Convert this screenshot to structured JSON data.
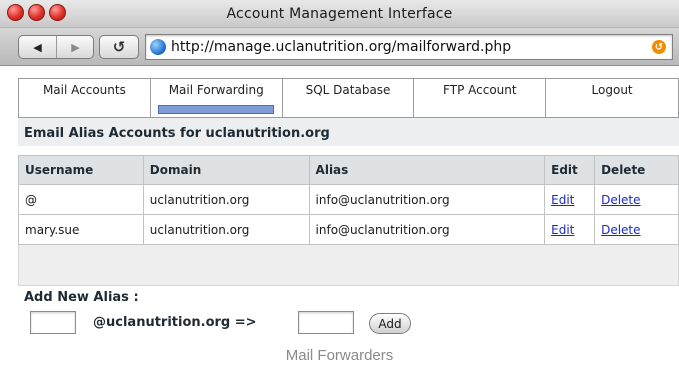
{
  "window": {
    "title": "Account Management Interface",
    "url": "http://manage.uclanutrition.org/mailforward.php"
  },
  "toolbar": {
    "back_glyph": "◀",
    "forward_glyph": "▶",
    "reload_glyph": "↺",
    "snapback_glyph": "↺"
  },
  "nav": {
    "items": [
      {
        "label": "Mail Accounts"
      },
      {
        "label": "Mail Forwarding"
      },
      {
        "label": "SQL Database"
      },
      {
        "label": "FTP Account"
      },
      {
        "label": "Logout"
      }
    ],
    "active_index": 1
  },
  "section_title": "Email Alias Accounts for uclanutrition.org",
  "table": {
    "headers": [
      "Username",
      "Domain",
      "Alias",
      "Edit",
      "Delete"
    ],
    "rows": [
      {
        "username": "@",
        "domain": "uclanutrition.org",
        "alias": "info@uclanutrition.org",
        "edit": "Edit",
        "delete": "Delete"
      },
      {
        "username": "mary.sue",
        "domain": "uclanutrition.org",
        "alias": "info@uclanutrition.org",
        "edit": "Edit",
        "delete": "Delete"
      }
    ]
  },
  "add_form": {
    "title": "Add New Alias :",
    "domain_suffix": "@uclanutrition.org =>",
    "alias_value": "",
    "target_value": "",
    "button_label": "Add"
  },
  "caption": "Mail Forwarders",
  "colors": {
    "link": "#1a28c7",
    "active_tab_marker": "#7f9bd8",
    "close_button": "#e0332a"
  }
}
